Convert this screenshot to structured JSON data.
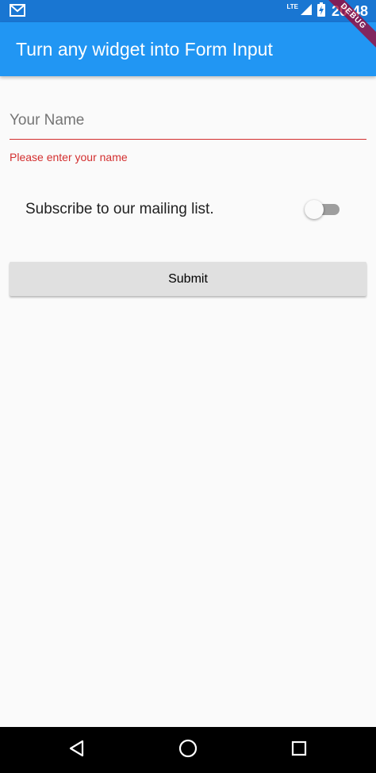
{
  "status_bar": {
    "network_label": "LTE",
    "time": "20:48",
    "icons": [
      "gmail-icon",
      "signal-icon",
      "battery-charging-icon"
    ]
  },
  "debug_banner": {
    "label": "DEBUG"
  },
  "app_bar": {
    "title": "Turn any widget into Form Input",
    "color": "#2196F3"
  },
  "form": {
    "name_field": {
      "placeholder": "Your Name",
      "value": "",
      "error": "Please enter your name",
      "error_color": "#D32F2F"
    },
    "subscribe": {
      "label": "Subscribe to our mailing list.",
      "checked": false
    },
    "submit_label": "Submit"
  },
  "nav_bar": {
    "icons": [
      "back-icon",
      "home-icon",
      "recent-apps-icon"
    ]
  }
}
